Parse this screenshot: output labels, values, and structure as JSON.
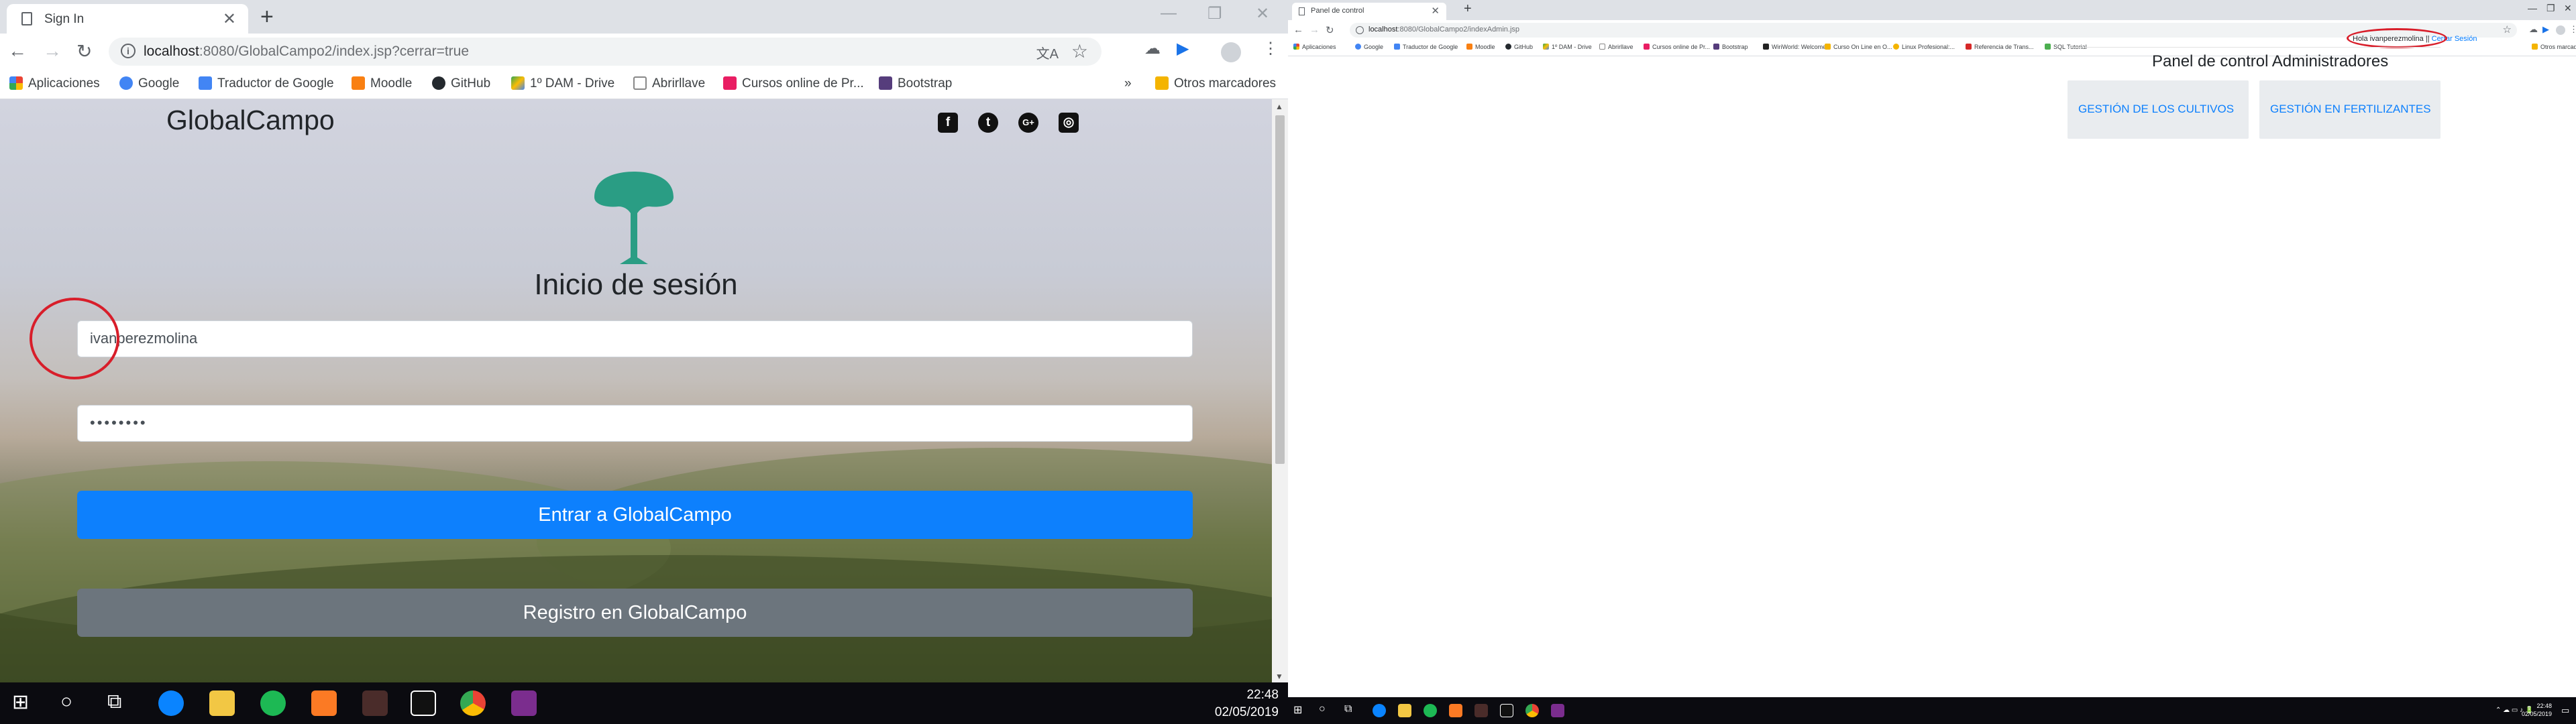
{
  "left": {
    "tab": {
      "title": "Sign In"
    },
    "address": {
      "host": "localhost",
      "rest": ":8080/GlobalCampo2/index.jsp?cerrar=true"
    },
    "bookmarks": [
      "Aplicaciones",
      "Google",
      "Traductor de Google",
      "Moodle",
      "GitHub",
      "1º DAM - Drive",
      "Abrirllave",
      "Cursos online de Pr...",
      "Bootstrap"
    ],
    "other_bookmarks": "Otros marcadores",
    "page": {
      "brand": "GlobalCampo",
      "social": [
        "facebook",
        "twitter",
        "google-plus",
        "instagram"
      ],
      "heading": "Inicio de sesión",
      "username_value": "ivanperezmolina",
      "password_value": "••••••••",
      "login_button": "Entrar a GlobalCampo",
      "register_button": "Registro en GlobalCampo"
    },
    "taskbar": {
      "time": "22:48",
      "date": "02/05/2019"
    },
    "colors": {
      "primary": "#0d80fd",
      "secondary": "#6c757d",
      "annotation": "#d81e2a",
      "logo": "#2a9d84"
    }
  },
  "right": {
    "tab": {
      "title": "Panel de control"
    },
    "address": {
      "host": "localhost",
      "rest": ":8080/GlobalCampo2/indexAdmin.jsp"
    },
    "bookmarks": [
      "Aplicaciones",
      "Google",
      "Traductor de Google",
      "Moodle",
      "GitHub",
      "1º DAM - Drive",
      "Abrirllave",
      "Cursos online de Pr...",
      "Bootstrap",
      "WiriWorld: Welcome",
      "Curso On Line en O...",
      "Linux Profesional:...",
      "Referencia de Trans...",
      "SQL Tutorial"
    ],
    "other_bookmarks": "Otros marcadores",
    "page": {
      "greeting_prefix": "Hola ivanperezmolina",
      "separator": "||",
      "logout_link": "Cerrar Sesión",
      "heading": "Panel de control Administradores",
      "cards": [
        "GESTIÓN DE LOS CULTIVOS",
        "GESTIÓN EN FERTILIZANTES"
      ]
    },
    "taskbar": {
      "time": "22:48",
      "date": "02/05/2019"
    }
  }
}
